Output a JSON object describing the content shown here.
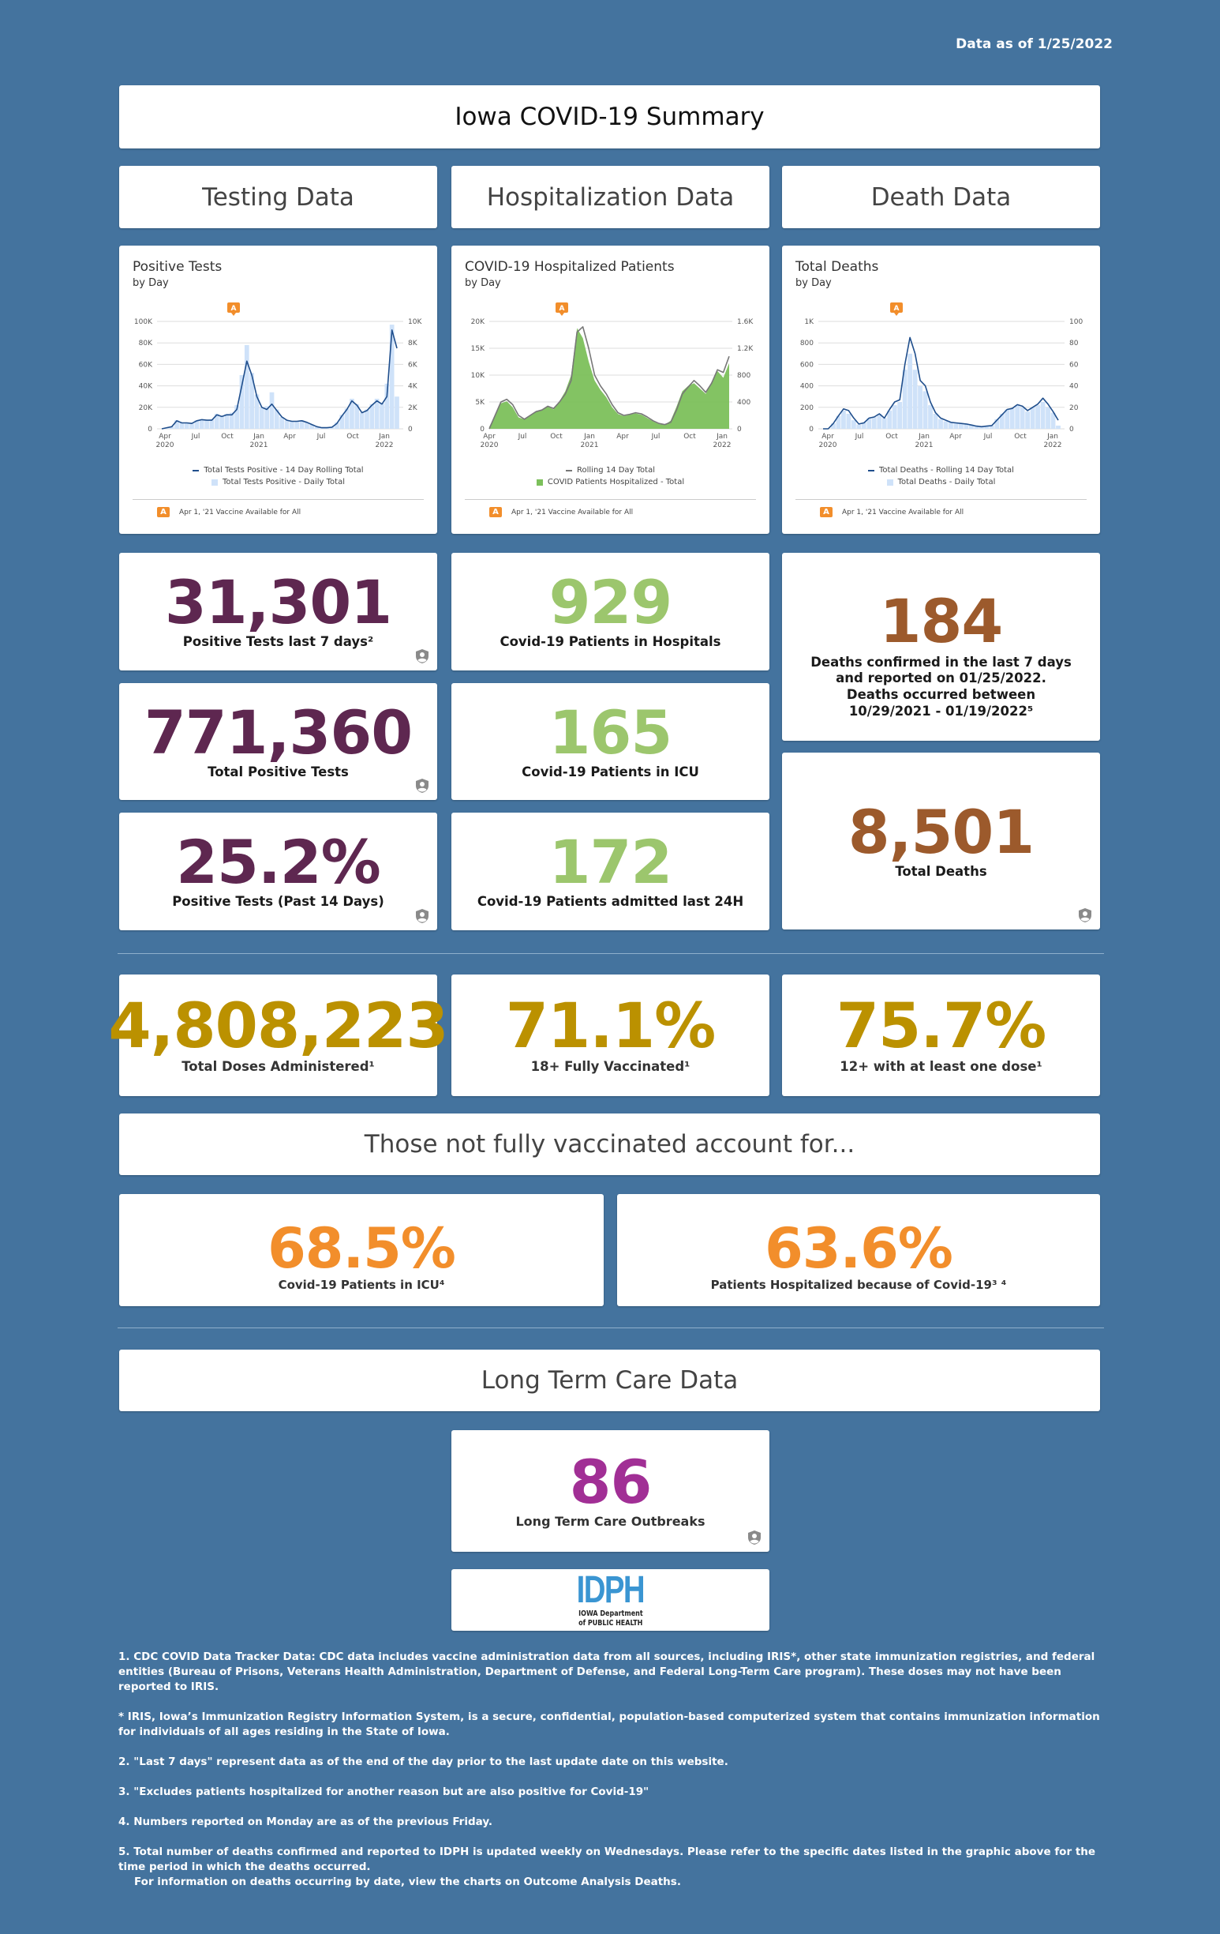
{
  "header": {
    "data_as_of": "Data as of 1/25/2022",
    "title": "Iowa COVID-19 Summary"
  },
  "sections": {
    "testing": "Testing Data",
    "hospitalization": "Hospitalization Data",
    "death": "Death Data"
  },
  "colors": {
    "background": "#44739e",
    "testing": "#5e2750",
    "hospital": "#9cc66d",
    "death": "#9c5a2c",
    "vaccine": "#bb9100",
    "unvaccinated": "#f28e2b",
    "ltc": "#a12f95",
    "annotation": "#f28e2b"
  },
  "testing_stats": [
    {
      "value": "31,301",
      "label": "Positive Tests last 7 days²"
    },
    {
      "value": "771,360",
      "label": "Total Positive Tests"
    },
    {
      "value": "25.2%",
      "label": "Positive Tests (Past 14 Days)"
    }
  ],
  "hospital_stats": [
    {
      "value": "929",
      "label": "Covid-19 Patients in Hospitals"
    },
    {
      "value": "165",
      "label": "Covid-19 Patients in ICU"
    },
    {
      "value": "172",
      "label": "Covid-19 Patients admitted last 24H"
    }
  ],
  "death_stats": [
    {
      "value": "184",
      "label_lines": [
        "Deaths confirmed in the last 7 days",
        "and reported on 01/25/2022.",
        "Deaths occurred between",
        "10/29/2021 - 01/19/2022⁵"
      ]
    },
    {
      "value": "8,501",
      "label": "Total Deaths"
    }
  ],
  "vaccine_stats": [
    {
      "value": "4,808,223",
      "label": "Total Doses Administered¹"
    },
    {
      "value": "71.1%",
      "label": "18+ Fully Vaccinated¹"
    },
    {
      "value": "75.7%",
      "label": "12+ with at least one dose¹"
    }
  ],
  "unvaccinated": {
    "header": "Those not fully vaccinated account for...",
    "stats": [
      {
        "value": "68.5%",
        "label": "Covid-19 Patients in ICU⁴"
      },
      {
        "value": "63.6%",
        "label": "Patients Hospitalized because of Covid-19³ ⁴"
      }
    ]
  },
  "ltc": {
    "header": "Long Term Care Data",
    "value": "86",
    "label": "Long Term Care Outbreaks"
  },
  "logo": {
    "big": "IDPH",
    "line1": "IOWA Department",
    "line2": "of PUBLIC HEALTH"
  },
  "footnotes": [
    "1. CDC COVID Data Tracker Data: CDC data includes vaccine administration data from all sources, including IRIS*, other state immunization registries, and federal entities (Bureau of Prisons, Veterans Health Administration, Department of Defense, and Federal Long-Term Care program). These doses may not have been reported to IRIS.",
    "* IRIS, Iowa’s Immunization Registry Information System, is a secure, confidential, population-based computerized system that contains immunization information for individuals of all ages residing in the State of Iowa.",
    "2.  \"Last 7 days\" represent data as of the end of the day prior to the last update date on this website.",
    "3. \"Excludes patients hospitalized for another reason but are also positive for Covid-19\"",
    "4. Numbers reported on Monday are as of the previous Friday.",
    "5. Total number of deaths confirmed and reported to IDPH is updated weekly on Wednesdays.  Please refer to the specific dates listed in the graphic above for the time period in which the deaths occurred.",
    "For information on deaths occurring by date, view the charts on Outcome Analysis Deaths."
  ],
  "chart_data": [
    {
      "type": "bar+line",
      "title": "Positive Tests",
      "subtitle": "by Day",
      "x_ticks": [
        "Apr 2020",
        "Jul",
        "Oct",
        "Jan 2021",
        "Apr",
        "Jul",
        "Oct",
        "Jan 2022"
      ],
      "x_range": [
        "2020-03",
        "2022-01"
      ],
      "y_left": {
        "ticks": [
          "0",
          "20K",
          "40K",
          "60K",
          "80K",
          "100K"
        ],
        "range": [
          0,
          100000
        ]
      },
      "y_right": {
        "ticks": [
          "0",
          "2K",
          "4K",
          "6K",
          "8K",
          "10K"
        ],
        "range": [
          0,
          10000
        ]
      },
      "series": [
        {
          "name": "Total Tests Positive - 14 Day Rolling Total",
          "axis": "left",
          "kind": "line",
          "color": "#1f4e8c",
          "values": [
            0,
            1000,
            2000,
            7500,
            5500,
            5500,
            5000,
            7500,
            8500,
            8000,
            8000,
            13000,
            11500,
            13000,
            13000,
            18000,
            40000,
            63000,
            50000,
            30000,
            20000,
            18000,
            23000,
            17000,
            11000,
            8000,
            7000,
            7000,
            7500,
            6000,
            4000,
            2000,
            1000,
            1000,
            1500,
            5000,
            12000,
            18000,
            26000,
            22000,
            15000,
            17000,
            22000,
            26000,
            23000,
            30000,
            92000,
            75000
          ]
        },
        {
          "name": "Total Tests Positive - Daily Total",
          "axis": "right",
          "kind": "bar",
          "color": "#cfe2f9",
          "values": [
            0,
            100,
            200,
            800,
            600,
            600,
            500,
            800,
            900,
            800,
            900,
            1400,
            1200,
            1400,
            1500,
            2200,
            5000,
            7800,
            5200,
            3200,
            2000,
            2100,
            3400,
            1800,
            1100,
            800,
            700,
            700,
            800,
            600,
            400,
            200,
            100,
            100,
            200,
            600,
            1300,
            1900,
            2800,
            2300,
            1500,
            1800,
            2300,
            2800,
            2400,
            4200,
            9700,
            3000
          ]
        }
      ],
      "annotation": {
        "label": "A",
        "x": "Apr 1, 2021",
        "text": "Apr 1, '21 Vaccine Available for All"
      }
    },
    {
      "type": "area+line",
      "title": "COVID-19 Hospitalized Patients",
      "subtitle": "by Day",
      "x_ticks": [
        "Apr 2020",
        "Jul",
        "Oct",
        "Jan 2021",
        "Apr",
        "Jul",
        "Oct",
        "Jan 2022"
      ],
      "x_range": [
        "2020-04",
        "2022-01"
      ],
      "y_left": {
        "ticks": [
          "0",
          "5K",
          "10K",
          "15K",
          "20K"
        ],
        "range": [
          0,
          20000
        ]
      },
      "y_right": {
        "ticks": [
          "0",
          "400",
          "800",
          "1.2K",
          "1.6K"
        ],
        "range": [
          0,
          1600
        ]
      },
      "series": [
        {
          "name": "Rolling 14 Day Total",
          "axis": "left",
          "kind": "line",
          "color": "#777777",
          "values": [
            0,
            2500,
            5000,
            5500,
            4500,
            2500,
            1800,
            2500,
            3200,
            3500,
            4200,
            3800,
            5000,
            6500,
            9000,
            18000,
            19000,
            15000,
            10000,
            8000,
            6500,
            4500,
            3000,
            2500,
            2700,
            3000,
            2800,
            2200,
            1500,
            1000,
            800,
            1200,
            3500,
            6500,
            7800,
            9000,
            8000,
            6800,
            8500,
            11000,
            10500,
            13500
          ]
        },
        {
          "name": "COVID Patients Hospitalized - Total",
          "axis": "right",
          "kind": "area",
          "color": "#7cc05b",
          "values": [
            30,
            200,
            380,
            410,
            320,
            170,
            140,
            210,
            260,
            290,
            330,
            290,
            410,
            560,
            800,
            1500,
            1350,
            1000,
            720,
            580,
            470,
            320,
            220,
            190,
            210,
            230,
            210,
            160,
            110,
            70,
            60,
            120,
            330,
            560,
            640,
            680,
            600,
            520,
            700,
            860,
            760,
            980
          ]
        }
      ],
      "annotation": {
        "label": "A",
        "x": "Apr 1, 2021",
        "text": "Apr 1, '21 Vaccine Available for All"
      }
    },
    {
      "type": "bar+line",
      "title": "Total Deaths",
      "subtitle": "by Day",
      "x_ticks": [
        "Apr 2020",
        "Jul",
        "Oct",
        "Jan 2021",
        "Apr",
        "Jul",
        "Oct",
        "Jan 2022"
      ],
      "x_range": [
        "2020-03",
        "2022-01"
      ],
      "y_left": {
        "ticks": [
          "0",
          "200",
          "400",
          "600",
          "800",
          "1K"
        ],
        "range": [
          0,
          1000
        ]
      },
      "y_right": {
        "ticks": [
          "0",
          "20",
          "40",
          "60",
          "80",
          "100"
        ],
        "range": [
          0,
          100
        ]
      },
      "series": [
        {
          "name": "Total Deaths - Rolling 14 Day Total",
          "axis": "left",
          "kind": "line",
          "color": "#1f4e8c",
          "values": [
            0,
            0,
            50,
            120,
            185,
            170,
            100,
            45,
            55,
            100,
            110,
            140,
            100,
            180,
            250,
            270,
            600,
            850,
            700,
            450,
            400,
            250,
            150,
            100,
            80,
            60,
            55,
            50,
            45,
            35,
            25,
            20,
            25,
            30,
            80,
            130,
            180,
            190,
            225,
            210,
            170,
            200,
            230,
            285,
            230,
            160,
            80
          ]
        },
        {
          "name": "Total Deaths - Daily Total",
          "axis": "right",
          "kind": "bar",
          "color": "#cfe2f9",
          "values": [
            0,
            0,
            5,
            12,
            17,
            14,
            8,
            4,
            6,
            10,
            11,
            14,
            10,
            17,
            22,
            25,
            55,
            70,
            55,
            40,
            35,
            22,
            14,
            9,
            7,
            6,
            6,
            5,
            5,
            4,
            3,
            2,
            3,
            3,
            9,
            14,
            18,
            19,
            22,
            20,
            16,
            20,
            22,
            25,
            20,
            15,
            3
          ]
        }
      ],
      "annotation": {
        "label": "A",
        "x": "Apr 1, 2021",
        "text": "Apr 1, '21 Vaccine Available for All"
      }
    }
  ]
}
